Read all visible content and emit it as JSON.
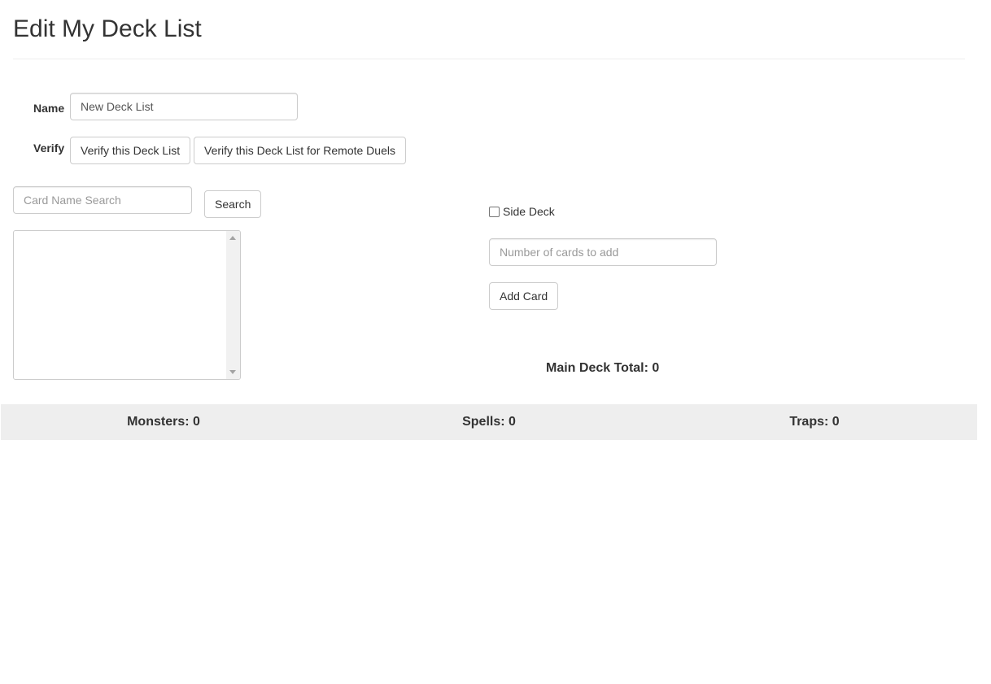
{
  "header": {
    "title": "Edit My Deck List"
  },
  "form": {
    "name_label": "Name",
    "name_value": "New Deck List",
    "verify_label": "Verify",
    "verify_button": "Verify this Deck List",
    "verify_remote_button": "Verify this Deck List for Remote Duels"
  },
  "search": {
    "placeholder": "Card Name Search",
    "button": "Search"
  },
  "add_panel": {
    "side_deck_label": "Side Deck",
    "side_deck_checked": false,
    "count_placeholder": "Number of cards to add",
    "add_button": "Add Card"
  },
  "totals": {
    "main_deck": "Main Deck Total: 0",
    "monsters": "Monsters: 0",
    "spells": "Spells: 0",
    "traps": "Traps: 0"
  }
}
